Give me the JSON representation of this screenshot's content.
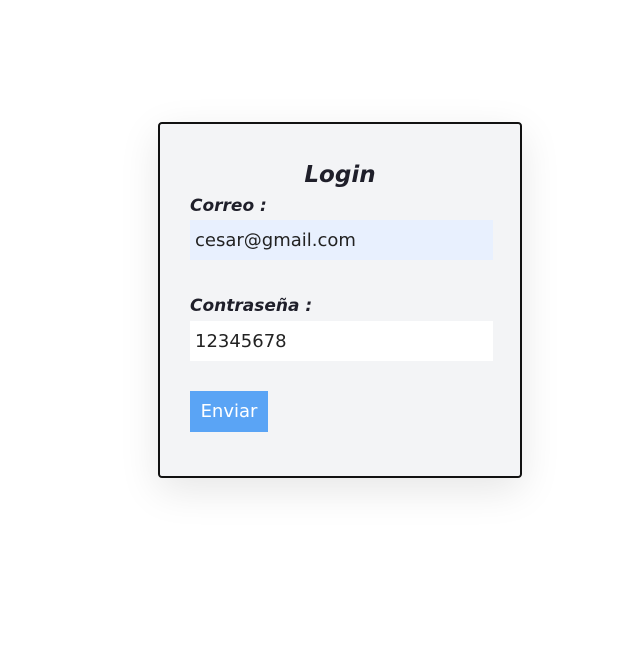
{
  "login": {
    "title": "Login",
    "email_label": "Correo :",
    "email_value": "cesar@gmail.com",
    "password_label": "Contraseña :",
    "password_value": "12345678",
    "submit_label": "Enviar"
  },
  "colors": {
    "card_background": "#f3f4f6",
    "card_border": "#111111",
    "email_field_background": "#e8f0fe",
    "password_field_background": "#ffffff",
    "button_background": "#5aa4f5",
    "button_text": "#ffffff",
    "text": "#1f1f2a"
  }
}
